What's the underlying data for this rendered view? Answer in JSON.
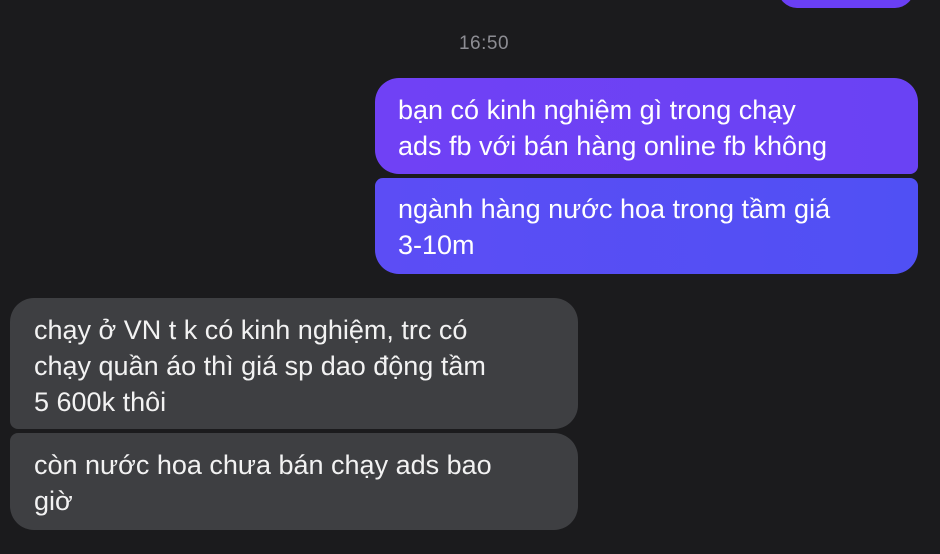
{
  "conversation": {
    "timestamp": "16:50",
    "messages": [
      {
        "sender": "me",
        "text": "bạn có kinh nghiệm gì trong chạy\nads fb với bán hàng online fb không"
      },
      {
        "sender": "me",
        "text": "ngành hàng nước hoa trong tầm giá\n3-10m"
      },
      {
        "sender": "other",
        "text": "chạy ở VN t k có kinh nghiệm, trc có\nchạy quần áo thì giá sp dao động tầm\n5 600k thôi"
      },
      {
        "sender": "other",
        "text": "còn nước hoa chưa bán chạy ads bao\ngiờ"
      }
    ]
  },
  "colors": {
    "background": "#1b1b1d",
    "sent_bubble": "#6a42f4",
    "received_bubble": "#3e3f42",
    "timestamp_text": "#8d8d93"
  }
}
